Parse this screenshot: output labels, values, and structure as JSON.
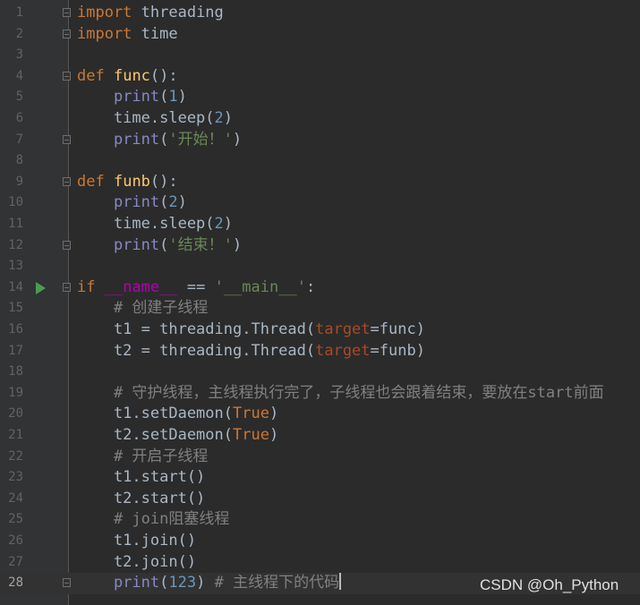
{
  "editor": {
    "lines": [
      {
        "n": "1",
        "text": "import threading"
      },
      {
        "n": "2",
        "text": "import time"
      },
      {
        "n": "3",
        "text": ""
      },
      {
        "n": "4",
        "text": "def func():"
      },
      {
        "n": "5",
        "text": "    print(1)"
      },
      {
        "n": "6",
        "text": "    time.sleep(2)"
      },
      {
        "n": "7",
        "text": "    print('开始！')"
      },
      {
        "n": "8",
        "text": ""
      },
      {
        "n": "9",
        "text": "def funb():"
      },
      {
        "n": "10",
        "text": "    print(2)"
      },
      {
        "n": "11",
        "text": "    time.sleep(2)"
      },
      {
        "n": "12",
        "text": "    print('结束！')"
      },
      {
        "n": "13",
        "text": ""
      },
      {
        "n": "14",
        "text": "if __name__ == '__main__':"
      },
      {
        "n": "15",
        "text": "    # 创建子线程"
      },
      {
        "n": "16",
        "text": "    t1 = threading.Thread(target=func)"
      },
      {
        "n": "17",
        "text": "    t2 = threading.Thread(target=funb)"
      },
      {
        "n": "18",
        "text": ""
      },
      {
        "n": "19",
        "text": "    # 守护线程，主线程执行完了，子线程也会跟着结束，要放在start前面"
      },
      {
        "n": "20",
        "text": "    t1.setDaemon(True)"
      },
      {
        "n": "21",
        "text": "    t2.setDaemon(True)"
      },
      {
        "n": "22",
        "text": "    # 开启子线程"
      },
      {
        "n": "23",
        "text": "    t1.start()"
      },
      {
        "n": "24",
        "text": "    t2.start()"
      },
      {
        "n": "25",
        "text": "    # join阻塞线程"
      },
      {
        "n": "26",
        "text": "    t1.join()"
      },
      {
        "n": "27",
        "text": "    t2.join()"
      },
      {
        "n": "28",
        "text": "    print(123) # 主线程下的代码"
      }
    ],
    "current_line": "28",
    "run_marker_line": "14"
  },
  "watermark": "CSDN @Oh_Python",
  "colors": {
    "background": "#2b2b2b",
    "gutter": "#313335",
    "keyword": "#cc7832",
    "function": "#ffc66d",
    "number": "#6897bb",
    "string": "#6a8759",
    "comment": "#808080",
    "builtin": "#8888c6",
    "parameter": "#aa4926",
    "run_arrow": "#499c54"
  },
  "icons": [
    "fold-marker-icon",
    "run-arrow-icon"
  ]
}
